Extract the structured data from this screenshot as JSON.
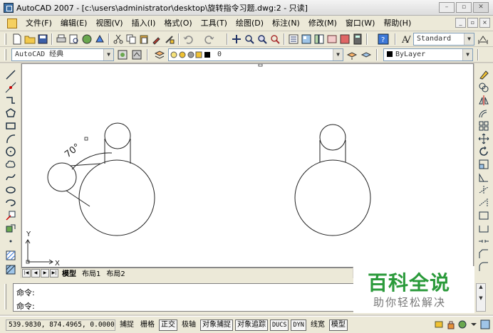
{
  "window": {
    "title": "AutoCAD 2007 - [c:\\users\\administrator\\desktop\\旋转指令习题.dwg:2 - 只读]"
  },
  "window_buttons": [
    "–",
    "▫",
    "✕"
  ],
  "menu": {
    "items": [
      "文件(F)",
      "编辑(E)",
      "视图(V)",
      "插入(I)",
      "格式(O)",
      "工具(T)",
      "绘图(D)",
      "标注(N)",
      "修改(M)",
      "窗口(W)",
      "帮助(H)"
    ],
    "mdi_buttons": [
      "_",
      "▫",
      "×"
    ]
  },
  "toolbar1": {
    "text_style": "Standard"
  },
  "toolbar2": {
    "workspace": "AutoCAD 经典",
    "layer": "0",
    "color": "ByLayer"
  },
  "drawing": {
    "angle_label": "70°",
    "ucs_y": "Y",
    "ucs_x": "X"
  },
  "layout_tabs": {
    "nav": [
      "|◀",
      "◀",
      "▶",
      "▶|"
    ],
    "tabs": [
      "模型",
      "布局1",
      "布局2"
    ]
  },
  "command": {
    "lines": [
      "命令:",
      "命令:"
    ]
  },
  "status": {
    "coords": "539.9830, 874.4965, 0.0000",
    "buttons": [
      {
        "label": "捕捉",
        "on": false
      },
      {
        "label": "栅格",
        "on": false
      },
      {
        "label": "正交",
        "on": true
      },
      {
        "label": "极轴",
        "on": false
      },
      {
        "label": "对象捕捉",
        "on": true
      },
      {
        "label": "对象追踪",
        "on": true
      },
      {
        "label": "DUCS",
        "on": true
      },
      {
        "label": "DYN",
        "on": true
      },
      {
        "label": "线宽",
        "on": false
      },
      {
        "label": "模型",
        "on": true
      }
    ]
  },
  "watermark": {
    "title": "百科全说",
    "subtitle": "助你轻松解决"
  }
}
